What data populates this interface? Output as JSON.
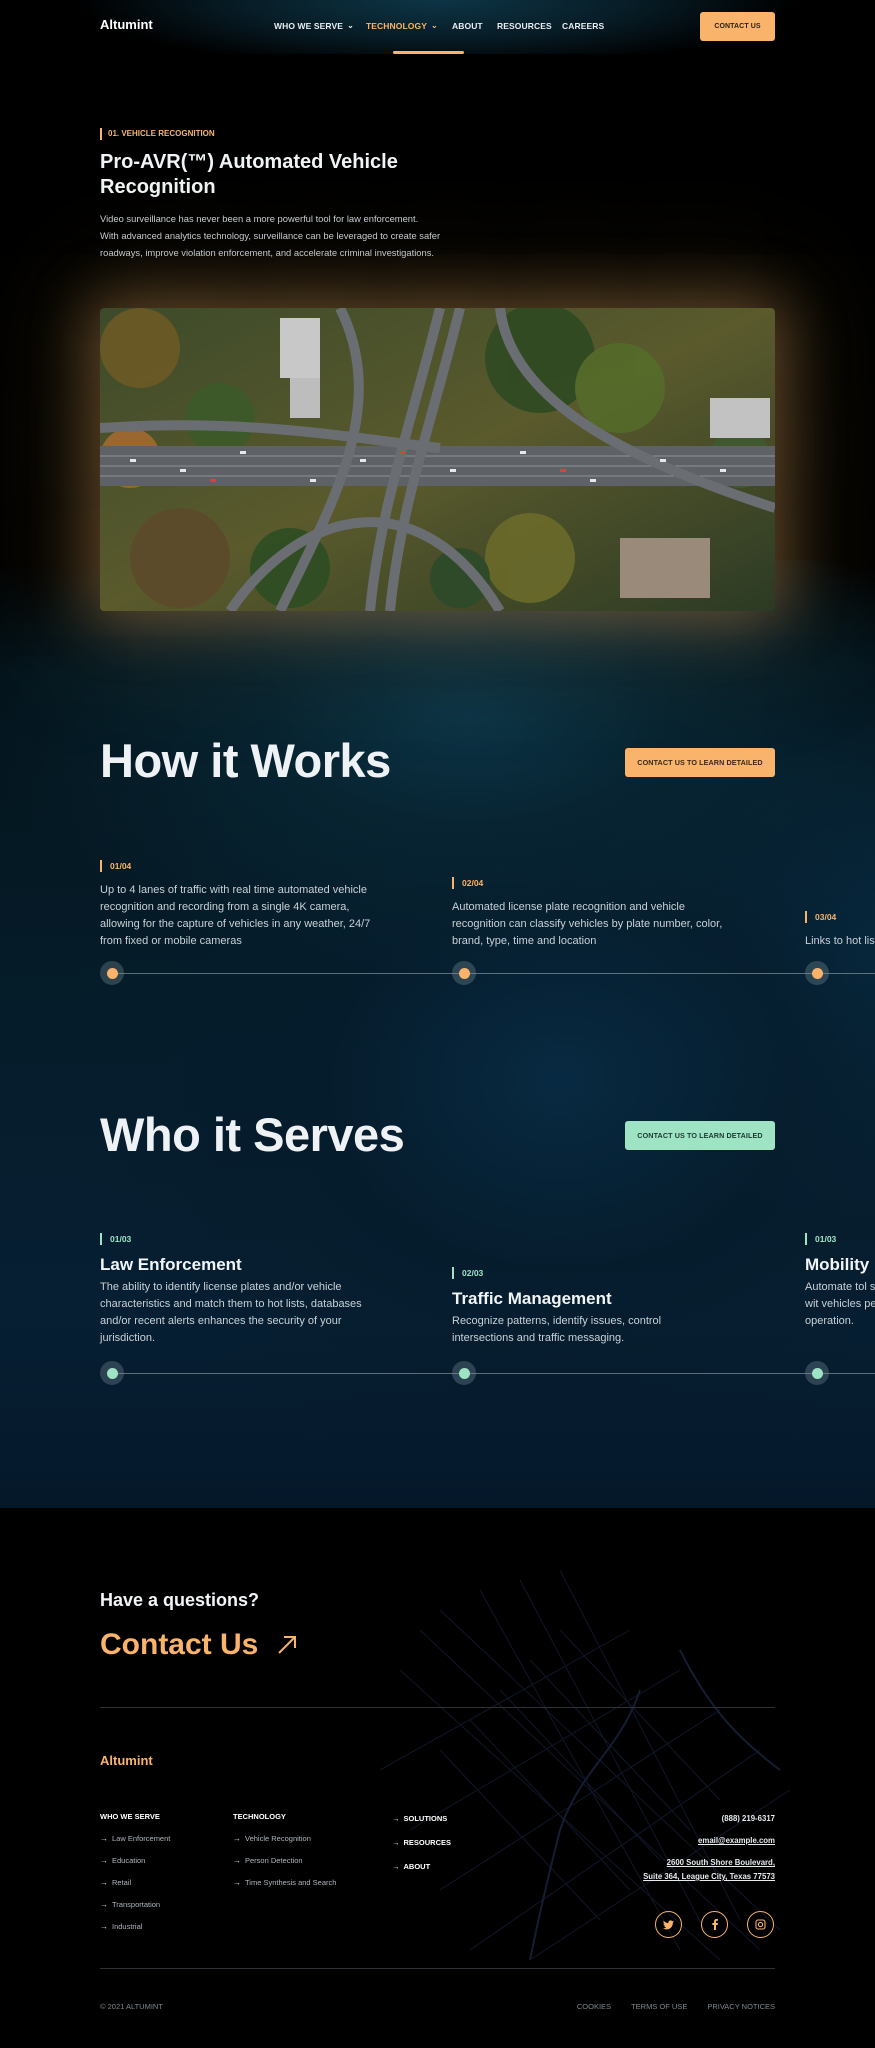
{
  "header": {
    "logo": "Altumint",
    "nav": [
      {
        "label": "WHO WE SERVE",
        "chevron": true,
        "active": false
      },
      {
        "label": "TECHNOLOGY",
        "chevron": true,
        "active": true
      },
      {
        "label": "ABOUT",
        "chevron": false,
        "active": false
      },
      {
        "label": "RESOURCES",
        "chevron": false,
        "active": false
      },
      {
        "label": "CAREERS",
        "chevron": false,
        "active": false
      }
    ],
    "cta": "CONTACT US"
  },
  "section1": {
    "eyebrow": "01. VEHICLE RECOGNITION",
    "title": "Pro-AVR(™) Automated Vehicle Recognition",
    "desc_lines": [
      "Video surveillance has never been a more powerful tool for law enforcement.",
      "With advanced analytics technology, surveillance can be leveraged to create safer",
      "roadways, improve violation enforcement, and accelerate criminal investigations."
    ]
  },
  "how": {
    "title": "How it Works",
    "cta": "CONTACT US TO LEARN DETAILED",
    "steps": [
      {
        "num": "01/04",
        "text": "Up to 4 lanes of traffic with real time automated vehicle recognition and recording from a single 4K camera, allowing for the capture of vehicles in any weather, 24/7 from fixed or mobile cameras"
      },
      {
        "num": "02/04",
        "text": "Automated license plate recognition and vehicle recognition can classify vehicles by plate number, color, brand, type, time and  location"
      },
      {
        "num": "03/04",
        "text": "Links to hot lis"
      }
    ]
  },
  "serves": {
    "title": "Who it Serves",
    "cta": "CONTACT US TO LEARN DETAILED",
    "items": [
      {
        "num": "01/03",
        "head": "Law Enforcement",
        "text": "The ability to identify license plates and/or  vehicle characteristics and match them to hot lists, databases and/or recent alerts enhances the security of your jurisdiction."
      },
      {
        "num": "02/03",
        "head": "Traffic Management",
        "text": "Recognize patterns, identify issues, control intersections and traffic messaging."
      },
      {
        "num": "01/03",
        "head": "Mobility",
        "text": "Automate tol solutions wit vehicles per h operation."
      }
    ]
  },
  "footer": {
    "question": "Have a questions?",
    "contact": "Contact Us",
    "logo": "Altumint",
    "who_head": "WHO WE SERVE",
    "who_links": [
      "Law Enforcement",
      "Education",
      "Retail",
      "Transportation",
      "Industrial"
    ],
    "tech_head": "TECHNOLOGY",
    "tech_links": [
      "Vehicle Recognition",
      "Person Detection",
      "Time Synthesis and Search"
    ],
    "nav_links": [
      "SOLUTIONS",
      "RESOURCES",
      "ABOUT"
    ],
    "phone": "(888) 219-6317",
    "email": "email@example.com",
    "address1": "2600 South Shore Boulevard,",
    "address2": "Suite 364, League City, Texas 77573",
    "copyright": "© 2021 ALTUMINT",
    "legal": [
      "COOKIES",
      "TERMS OF USE",
      "PRIVACY NOTICES"
    ]
  },
  "colors": {
    "accent": "#f9b36a",
    "mint": "#9ee3c4",
    "bg": "#000000"
  },
  "icons": [
    "chevron-down-icon",
    "arrow-up-right-icon",
    "arrow-right-icon",
    "twitter-icon",
    "facebook-icon",
    "instagram-icon"
  ]
}
